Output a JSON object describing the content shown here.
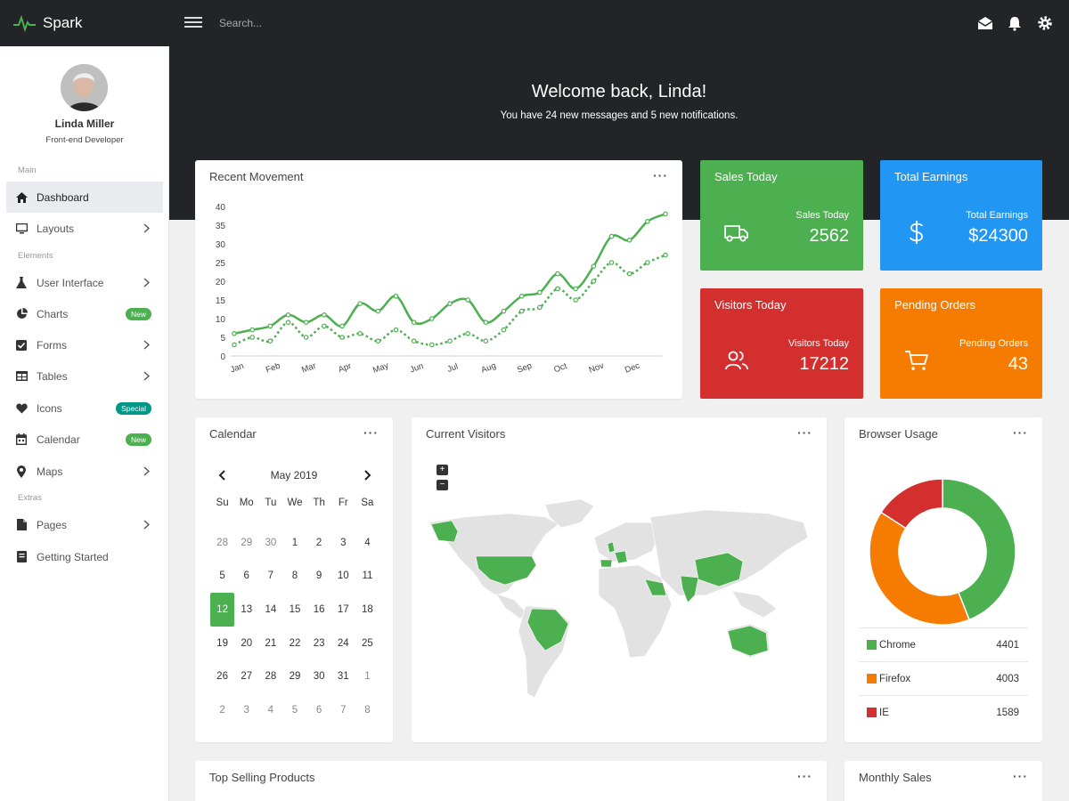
{
  "brand": {
    "name": "Spark"
  },
  "topbar": {
    "search_placeholder": "Search..."
  },
  "user": {
    "name": "Linda Miller",
    "role": "Front-end Developer"
  },
  "sidebar": {
    "sections": [
      "Main",
      "Elements",
      "Extras"
    ],
    "items": [
      {
        "label": "Dashboard"
      },
      {
        "label": "Layouts"
      },
      {
        "label": "User Interface"
      },
      {
        "label": "Charts",
        "badge": "New"
      },
      {
        "label": "Forms"
      },
      {
        "label": "Tables"
      },
      {
        "label": "Icons",
        "badge": "Special"
      },
      {
        "label": "Calendar",
        "badge": "New"
      },
      {
        "label": "Maps"
      },
      {
        "label": "Pages"
      },
      {
        "label": "Getting Started"
      }
    ]
  },
  "hero": {
    "title": "Welcome back, Linda!",
    "subtitle": "You have 24 new messages and 5 new notifications."
  },
  "stats": [
    {
      "title": "Sales Today",
      "label": "Sales Today",
      "value": "2562",
      "color": "#4caf50",
      "icon": "truck-icon"
    },
    {
      "title": "Total Earnings",
      "label": "Total Earnings",
      "value": "$24300",
      "color": "#2196f3",
      "icon": "dollar-icon"
    },
    {
      "title": "Visitors Today",
      "label": "Visitors Today",
      "value": "17212",
      "color": "#d32f2f",
      "icon": "users-icon"
    },
    {
      "title": "Pending Orders",
      "label": "Pending Orders",
      "value": "43",
      "color": "#f57c00",
      "icon": "cart-icon"
    }
  ],
  "cards": {
    "movement": "Recent Movement",
    "calendar": "Calendar",
    "visitors": "Current Visitors",
    "browser": "Browser Usage",
    "products": "Top Selling Products",
    "monthly": "Monthly Sales",
    "menu_glyph": "···"
  },
  "calendar": {
    "month": "May 2019",
    "weekdays": [
      "Su",
      "Mo",
      "Tu",
      "We",
      "Th",
      "Fr",
      "Sa"
    ],
    "weeks": [
      [
        {
          "d": "28",
          "o": true
        },
        {
          "d": "29",
          "o": true
        },
        {
          "d": "30",
          "o": true
        },
        {
          "d": "1"
        },
        {
          "d": "2"
        },
        {
          "d": "3"
        },
        {
          "d": "4"
        }
      ],
      [
        {
          "d": "5"
        },
        {
          "d": "6"
        },
        {
          "d": "7"
        },
        {
          "d": "8"
        },
        {
          "d": "9"
        },
        {
          "d": "10"
        },
        {
          "d": "11"
        }
      ],
      [
        {
          "d": "12",
          "sel": true
        },
        {
          "d": "13"
        },
        {
          "d": "14"
        },
        {
          "d": "15"
        },
        {
          "d": "16"
        },
        {
          "d": "17"
        },
        {
          "d": "18"
        }
      ],
      [
        {
          "d": "19"
        },
        {
          "d": "20"
        },
        {
          "d": "21"
        },
        {
          "d": "22"
        },
        {
          "d": "23"
        },
        {
          "d": "24"
        },
        {
          "d": "25"
        }
      ],
      [
        {
          "d": "26"
        },
        {
          "d": "27"
        },
        {
          "d": "28"
        },
        {
          "d": "29"
        },
        {
          "d": "30"
        },
        {
          "d": "31"
        },
        {
          "d": "1",
          "o": true
        }
      ],
      [
        {
          "d": "2",
          "o": true
        },
        {
          "d": "3",
          "o": true
        },
        {
          "d": "4",
          "o": true
        },
        {
          "d": "5",
          "o": true
        },
        {
          "d": "6",
          "o": true
        },
        {
          "d": "7",
          "o": true
        },
        {
          "d": "8",
          "o": true
        }
      ]
    ]
  },
  "map": {
    "zoom_in": "+",
    "zoom_out": "−",
    "highlight_color": "#4caf50",
    "land_color": "#e4e4e4"
  },
  "chart_data": [
    {
      "type": "line",
      "title": "Recent Movement",
      "categories": [
        "Jan",
        "Feb",
        "Mar",
        "Apr",
        "May",
        "Jun",
        "Jul",
        "Aug",
        "Sep",
        "Oct",
        "Nov",
        "Dec"
      ],
      "x": [
        0,
        0.5,
        1,
        1.5,
        2,
        2.5,
        3,
        3.5,
        4,
        4.5,
        5,
        5.5,
        6,
        6.5,
        7,
        7.5,
        8,
        8.5,
        9,
        9.5,
        10,
        10.5,
        11,
        11.5,
        12
      ],
      "series": [
        {
          "style": "solid",
          "color": "#4caf50",
          "values": [
            6,
            7,
            8,
            11,
            9,
            11,
            8,
            14,
            12,
            16,
            9,
            10,
            14,
            15,
            9,
            12,
            16,
            17,
            22,
            18,
            24,
            32,
            31,
            36,
            38
          ]
        },
        {
          "style": "dotted",
          "color": "#4caf50",
          "values": [
            3,
            5,
            4,
            9,
            5,
            8,
            5,
            6,
            4,
            7,
            4,
            3,
            4,
            6,
            4,
            7,
            12,
            13,
            18,
            15,
            20,
            25,
            22,
            25,
            27
          ]
        }
      ],
      "ylim": [
        0,
        40
      ],
      "yticks": [
        0,
        5,
        10,
        15,
        20,
        25,
        30,
        35,
        40
      ],
      "grid": false
    },
    {
      "type": "pie",
      "title": "Browser Usage",
      "categories": [
        "Chrome",
        "Firefox",
        "IE"
      ],
      "values": [
        4401,
        4003,
        1589
      ],
      "colors": [
        "#4caf50",
        "#f57c00",
        "#d32f2f"
      ]
    }
  ]
}
